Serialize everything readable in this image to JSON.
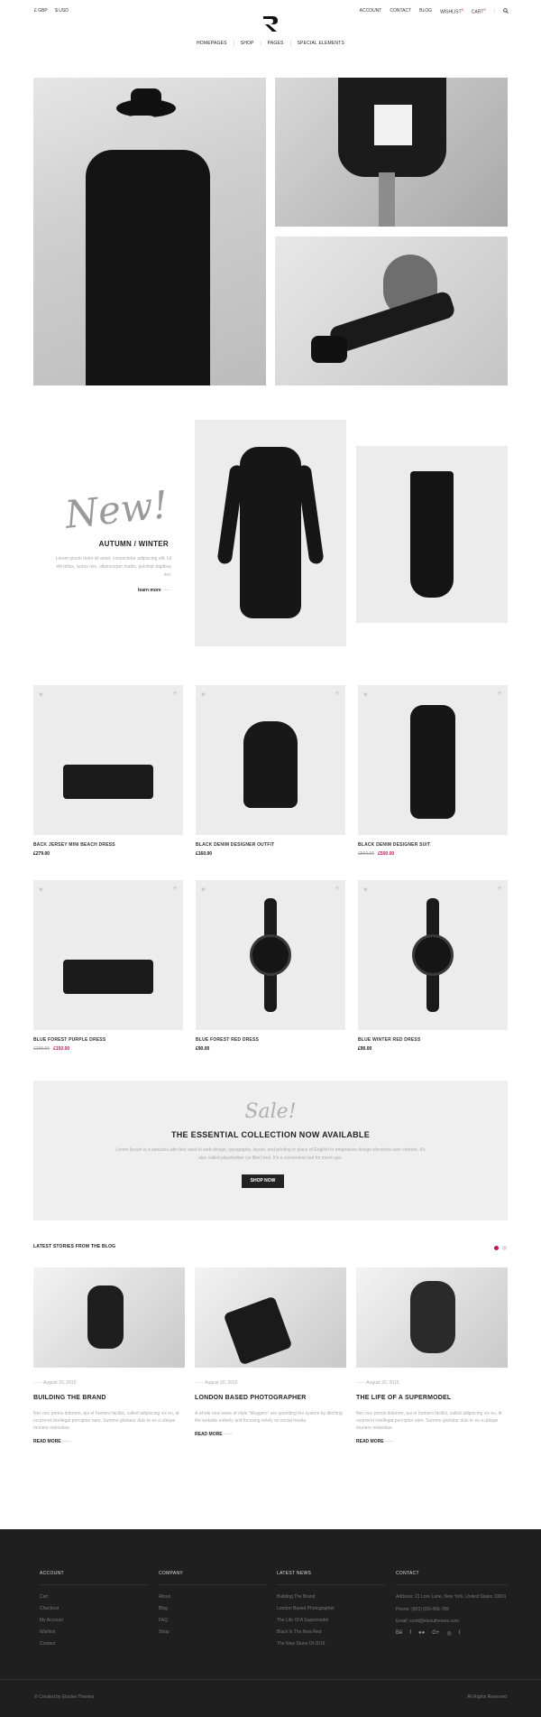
{
  "topbar": {
    "lang": "£ GBP",
    "currency": "$ USD"
  },
  "toplinks": {
    "account": "ACCOUNT",
    "contact": "CONTACT",
    "blog": "BLOG",
    "wishlist": "WISHLIST",
    "wishlist_count": "0",
    "cart": "CART",
    "cart_count": "0"
  },
  "nav": {
    "items": [
      "HOMEPAGES",
      "SHOP",
      "PAGES",
      "SPECIAL ELEMENTS"
    ]
  },
  "promo": {
    "script": "New!",
    "title": "AUTUMN / WINTER",
    "text": "Lorem ipsum dolor sit amet, consectetur adipiscing elit. Ut elit tellus, luctus nec, ullamcorper mattis, pulvinar dapibus leo.",
    "link": "learn more"
  },
  "products": [
    {
      "name": "BACK JERSEY MINI BEACH DRESS",
      "price": "£279.00",
      "old": "",
      "sale": ""
    },
    {
      "name": "BLACK DENIM DESIGNER OUTFIT",
      "price": "£160.00",
      "old": "",
      "sale": ""
    },
    {
      "name": "BLACK DENIM DESIGNER SUIT",
      "price": "",
      "old": "£550.00",
      "sale": "£500.00"
    },
    {
      "name": "BLUE FOREST PURPLE DRESS",
      "price": "",
      "old": "£195.00",
      "sale": "£150.00"
    },
    {
      "name": "BLUE FOREST RED DRESS",
      "price": "£90.00",
      "old": "",
      "sale": ""
    },
    {
      "name": "BLUE WINTER RED DRESS",
      "price": "£90.00",
      "old": "",
      "sale": ""
    }
  ],
  "sale": {
    "script": "Sale!",
    "title": "THE ESSENTIAL COLLECTION NOW AVAILABLE",
    "text": "Lorem Ipsum is a pseudo-Latin text used in web design, typography, layout, and printing in place of English to emphasise design elements over content. It's also called placeholder (or filler) text. It's a convenient tool for mock-ups.",
    "button": "SHOP NOW"
  },
  "blog": {
    "heading": "LATEST STORIES FROM THE BLOG",
    "posts": [
      {
        "date": "August 20, 2015",
        "title": "BUILDING THE BRAND",
        "text": "Nec nec primis dolorem, qui et homero facilisi, called adipiscing vix eu, id ocurreret intellegat percipitur nam. Summo gloriatur duis te es a ubique munere molestiae.",
        "more": "READ MORE"
      },
      {
        "date": "August 20, 2015",
        "title": "LONDON BASED PHOTOGRAPHER",
        "text": "A whole new wave of style \"bloggers\" are upsetting the system by ditching the website entirely and focusing solely on social media.",
        "more": "READ MORE"
      },
      {
        "date": "August 20, 2015",
        "title": "THE LIFE OF A SUPERMODEL",
        "text": "Nec nec primis dolorem, qui et homero facilisi, called adipiscing vix eu, id ocurreret intellegat percipitur nam. Summo gloriatur duis te es a ubique munere molestiae.",
        "more": "READ MORE"
      }
    ]
  },
  "footer": {
    "account": {
      "heading": "ACCOUNT",
      "items": [
        "Cart",
        "Checkout",
        "My Account",
        "Wishlist",
        "Contact"
      ]
    },
    "company": {
      "heading": "COMPANY",
      "items": [
        "About",
        "Blog",
        "FAQ",
        "Shop"
      ]
    },
    "news": {
      "heading": "LATEST NEWS",
      "items": [
        "Building The Brand",
        "London Based Photographer",
        "The Life Of A Supermodel",
        "Black Is The New Red",
        "The New Stuns Of 2016"
      ]
    },
    "contact": {
      "heading": "CONTACT",
      "address": "Address: 21 Lore Lane, New York, United States 10001",
      "phone": "Phone: (802) 000-456-789",
      "email": "Email: scott@eluxuthemes.com"
    },
    "copyright": "© Created by Elusive Themes",
    "rights": "All Rights Reserved"
  },
  "colors": {
    "accent": "#c2185b",
    "footer_bg": "#1f1f1f",
    "tile_bg": "#ececec"
  }
}
